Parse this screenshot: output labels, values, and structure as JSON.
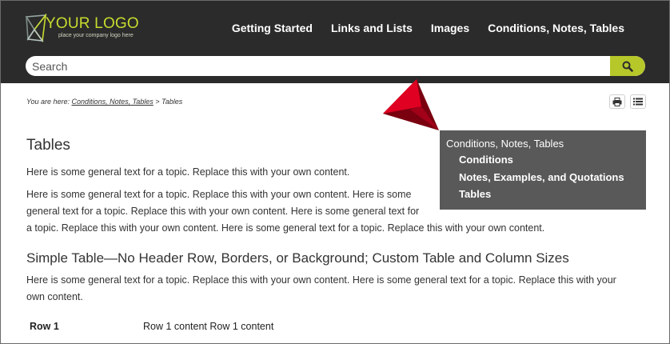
{
  "header": {
    "logo_text": "YOUR LOGO",
    "logo_tagline": "place your company logo here",
    "nav": [
      "Getting Started",
      "Links and Lists",
      "Images",
      "Conditions, Notes, Tables"
    ]
  },
  "search": {
    "placeholder": "Search",
    "value": ""
  },
  "breadcrumb": {
    "prefix": "You are here: ",
    "link": "Conditions, Notes, Tables",
    "separator": " > ",
    "current": "Tables"
  },
  "mini_toc": {
    "root": "Conditions, Notes, Tables",
    "items": [
      "Conditions",
      "Notes, Examples, and Quotations",
      "Tables"
    ]
  },
  "content": {
    "title": "Tables",
    "para1": "Here is some general text for a topic. Replace this with your own content.",
    "para2_lines": [
      "Here is some general text for a topic. Replace this with your own content. Here is some",
      "general text for a topic. Replace this with your own content. Here is some general text for",
      "a topic. Replace this with your own content. Here is some general text for a topic. Replace this with your own content."
    ],
    "subheading": "Simple Table—No Header Row, Borders, or Background; Custom Table and Column Sizes",
    "para3_lines": [
      "Here is some general text for a topic. Replace this with your own content. Here is some general text for a topic. Replace this with your",
      "own content."
    ],
    "table": [
      {
        "head": "Row 1",
        "value": "Row 1 content Row 1 content"
      }
    ]
  },
  "colors": {
    "header_bg": "#2b2b2b",
    "accent": "#b6c72a",
    "toc_bg": "#595959",
    "pointer": "#c8001e"
  },
  "icons": [
    "logo-mark-icon",
    "search-icon",
    "print-icon",
    "list-icon",
    "red-pointer-icon"
  ]
}
